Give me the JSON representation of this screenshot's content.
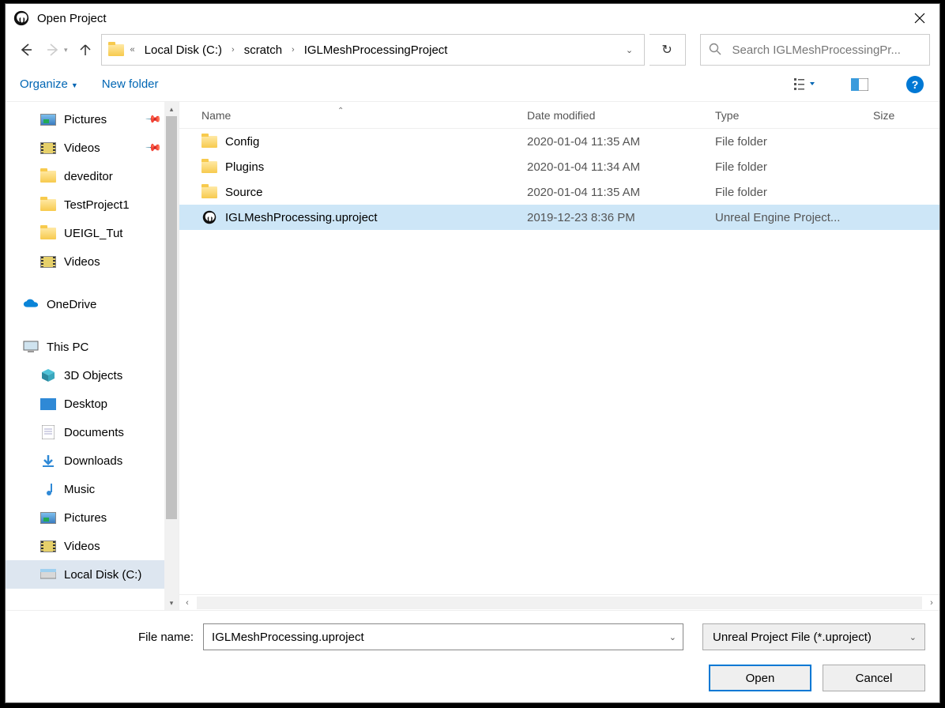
{
  "title": "Open Project",
  "breadcrumbs": [
    "Local Disk (C:)",
    "scratch",
    "IGLMeshProcessingProject"
  ],
  "search_placeholder": "Search IGLMeshProcessingPr...",
  "toolbar": {
    "organize": "Organize",
    "new_folder": "New folder"
  },
  "sidebar": [
    {
      "label": "Pictures",
      "icon": "picture",
      "pinned": true
    },
    {
      "label": "Videos",
      "icon": "video",
      "pinned": true
    },
    {
      "label": "deveditor",
      "icon": "folder"
    },
    {
      "label": "TestProject1",
      "icon": "folder"
    },
    {
      "label": "UEIGL_Tut",
      "icon": "folder"
    },
    {
      "label": "Videos",
      "icon": "video"
    }
  ],
  "roots": {
    "onedrive": "OneDrive",
    "thispc": "This PC"
  },
  "thispc_items": [
    {
      "label": "3D Objects",
      "icon": "3d"
    },
    {
      "label": "Desktop",
      "icon": "desktop"
    },
    {
      "label": "Documents",
      "icon": "doc"
    },
    {
      "label": "Downloads",
      "icon": "download"
    },
    {
      "label": "Music",
      "icon": "music"
    },
    {
      "label": "Pictures",
      "icon": "picture"
    },
    {
      "label": "Videos",
      "icon": "video"
    },
    {
      "label": "Local Disk (C:)",
      "icon": "disk",
      "selected": true
    }
  ],
  "columns": {
    "name": "Name",
    "date": "Date modified",
    "type": "Type",
    "size": "Size"
  },
  "files": [
    {
      "name": "Config",
      "date": "2020-01-04 11:35 AM",
      "type": "File folder",
      "icon": "folder"
    },
    {
      "name": "Plugins",
      "date": "2020-01-04 11:34 AM",
      "type": "File folder",
      "icon": "folder"
    },
    {
      "name": "Source",
      "date": "2020-01-04 11:35 AM",
      "type": "File folder",
      "icon": "folder"
    },
    {
      "name": "IGLMeshProcessing.uproject",
      "date": "2019-12-23 8:36 PM",
      "type": "Unreal Engine Project...",
      "icon": "ue",
      "selected": true
    }
  ],
  "footer": {
    "file_name_label": "File name:",
    "file_name_value": "IGLMeshProcessing.uproject",
    "filter": "Unreal Project File (*.uproject)",
    "open": "Open",
    "cancel": "Cancel"
  }
}
